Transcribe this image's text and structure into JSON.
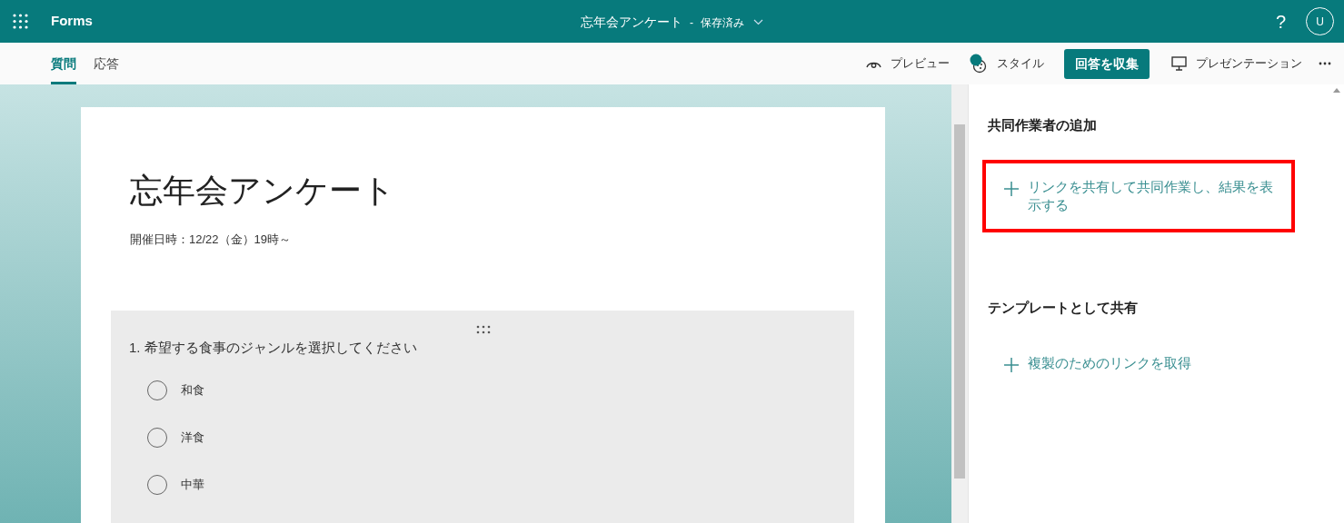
{
  "app_bar": {
    "app_name": "Forms",
    "form_title": "忘年会アンケート",
    "separator": "-",
    "save_status": "保存済み",
    "help": "?",
    "avatar": "U"
  },
  "tabs": [
    {
      "label": "質問",
      "selected": true
    },
    {
      "label": "応答",
      "selected": false
    }
  ],
  "toolbar": {
    "preview": "プレビュー",
    "style": "スタイル",
    "collect": "回答を収集",
    "present": "プレゼンテーション"
  },
  "form": {
    "title": "忘年会アンケート",
    "description": "開催日時：12/22（金）19時～",
    "questions": [
      {
        "text": "1. 希望する食事のジャンルを選択してください",
        "options": [
          {
            "label": "和食",
            "selected": false
          },
          {
            "label": "洋食",
            "selected": false
          },
          {
            "label": "中華",
            "selected": false
          }
        ]
      }
    ]
  },
  "side_panel": {
    "sections": [
      {
        "heading": "共同作業者の追加",
        "action": "リンクを共有して共同作業し、結果を表示する",
        "highlighted": true
      },
      {
        "heading": "テンプレートとして共有",
        "action": "複製のためのリンクを取得",
        "highlighted": false
      }
    ]
  }
}
